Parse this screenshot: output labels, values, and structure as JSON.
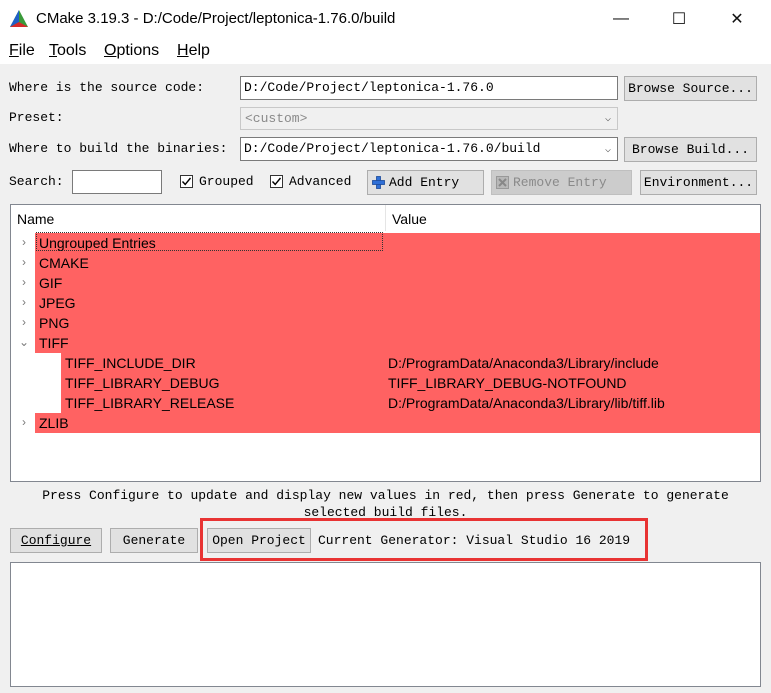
{
  "window": {
    "title": "CMake 3.19.3 - D:/Code/Project/leptonica-1.76.0/build",
    "minimize": "—",
    "maximize": "☐",
    "close": "✕"
  },
  "menu": {
    "items": [
      {
        "key": "F",
        "rest": "ile"
      },
      {
        "key": "T",
        "rest": "ools"
      },
      {
        "key": "O",
        "rest": "ptions"
      },
      {
        "key": "H",
        "rest": "elp"
      }
    ]
  },
  "source": {
    "label": "Where is the source code:",
    "value": "D:/Code/Project/leptonica-1.76.0",
    "browse_label": "Browse Source..."
  },
  "preset": {
    "label": "Preset:",
    "value": "<custom>"
  },
  "binaries": {
    "label": "Where to build the binaries:",
    "value": "D:/Code/Project/leptonica-1.76.0/build",
    "browse_label": "Browse Build..."
  },
  "toolbar": {
    "search_label": "Search:",
    "search_value": "",
    "grouped_label": "Grouped",
    "grouped_checked": true,
    "advanced_label": "Advanced",
    "advanced_checked": true,
    "add_entry_label": "Add Entry",
    "remove_entry_label": "Remove Entry",
    "environment_label": "Environment..."
  },
  "tree": {
    "header_name": "Name",
    "header_value": "Value",
    "rows": [
      {
        "name": "Ungrouped Entries",
        "value": "",
        "level": 0,
        "arrow": "›",
        "red": true
      },
      {
        "name": "CMAKE",
        "value": "",
        "level": 0,
        "arrow": "›",
        "red": true
      },
      {
        "name": "GIF",
        "value": "",
        "level": 0,
        "arrow": "›",
        "red": true
      },
      {
        "name": "JPEG",
        "value": "",
        "level": 0,
        "arrow": "›",
        "red": true
      },
      {
        "name": "PNG",
        "value": "",
        "level": 0,
        "arrow": "›",
        "red": true
      },
      {
        "name": "TIFF",
        "value": "",
        "level": 0,
        "arrow": "⌄",
        "red": true
      },
      {
        "name": "TIFF_INCLUDE_DIR",
        "value": "D:/ProgramData/Anaconda3/Library/include",
        "level": 1,
        "arrow": "",
        "red": true
      },
      {
        "name": "TIFF_LIBRARY_DEBUG",
        "value": "TIFF_LIBRARY_DEBUG-NOTFOUND",
        "level": 1,
        "arrow": "",
        "red": true
      },
      {
        "name": "TIFF_LIBRARY_RELEASE",
        "value": "D:/ProgramData/Anaconda3/Library/lib/tiff.lib",
        "level": 1,
        "arrow": "",
        "red": true
      },
      {
        "name": "ZLIB",
        "value": "",
        "level": 0,
        "arrow": "›",
        "red": true
      }
    ]
  },
  "hint": {
    "line1": "Press Configure to update and display new values in red, then press Generate to generate",
    "line2": "selected build files."
  },
  "actions": {
    "configure_label": "Configure",
    "generate_label": "Generate",
    "open_project_label": "Open Project",
    "generator_text": "Current Generator: Visual Studio 16 2019"
  },
  "colors": {
    "changed_row": "#ff6262",
    "highlight_frame": "#e83333"
  }
}
